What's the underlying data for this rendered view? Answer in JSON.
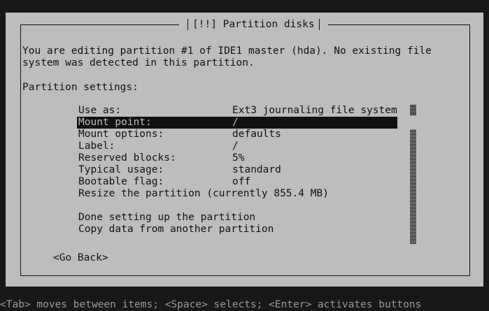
{
  "dialog": {
    "title": "[!!] Partition disks",
    "intro_line1": "You are editing partition #1 of IDE1 master (hda). No existing file",
    "intro_line2": "system was detected in this partition.",
    "heading": "Partition settings:",
    "settings": [
      {
        "key": "Use as:",
        "value": "Ext3 journaling file system"
      },
      {
        "key": "Mount point:",
        "value": "/"
      },
      {
        "key": "Mount options:",
        "value": "defaults"
      },
      {
        "key": "Label:",
        "value": "/"
      },
      {
        "key": "Reserved blocks:",
        "value": "5%"
      },
      {
        "key": "Typical usage:",
        "value": "standard"
      },
      {
        "key": "Bootable flag:",
        "value": "off"
      }
    ],
    "resize_action": "Resize the partition (currently 855.4 MB)",
    "done_action": "Done setting up the partition",
    "copy_action": "Copy data from another partition",
    "go_back": "<Go Back>"
  },
  "hint_bar": "<Tab> moves between items; <Space> selects; <Enter> activates buttons",
  "colors": {
    "background": "#181818",
    "dialog": "#bdbdbd",
    "selection": "#111111"
  }
}
